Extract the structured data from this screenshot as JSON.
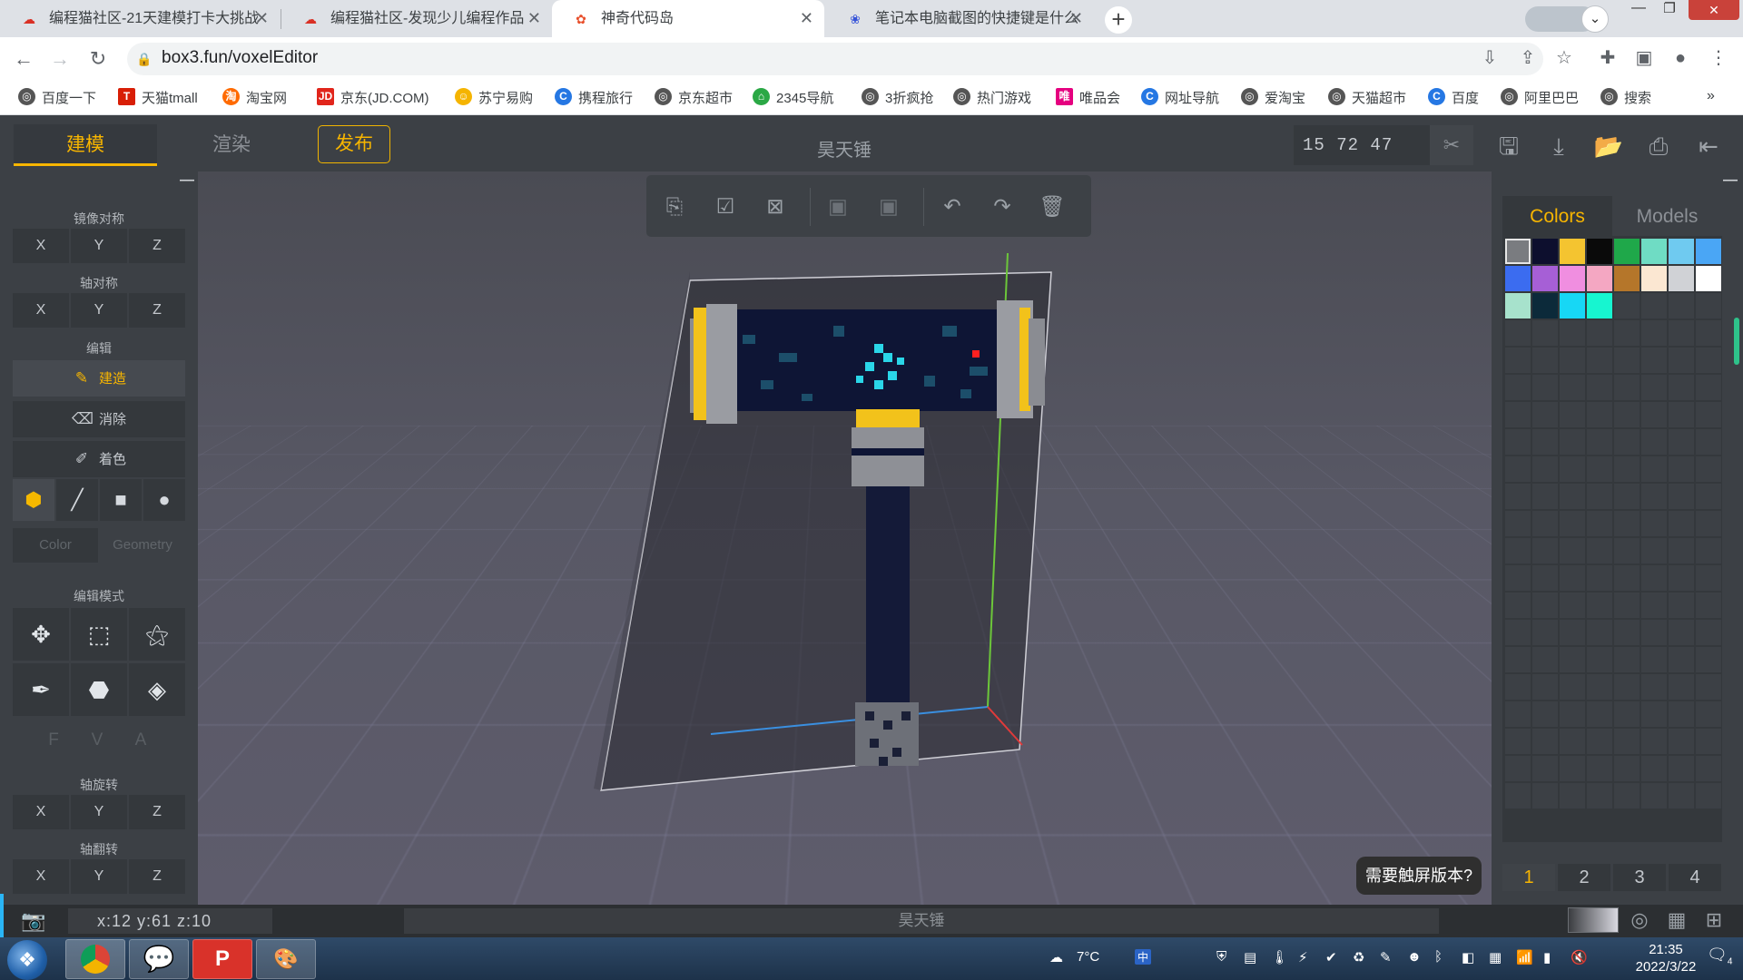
{
  "browser": {
    "tabs": [
      {
        "title": "编程猫社区-21天建模打卡大挑战",
        "active": false
      },
      {
        "title": "编程猫社区-发现少儿编程作品",
        "active": false
      },
      {
        "title": "神奇代码岛",
        "active": true
      },
      {
        "title": "笔记本电脑截图的快捷键是什么",
        "active": false
      }
    ],
    "url": "box3.fun/voxelEditor",
    "bookmarks": [
      "百度一下",
      "天猫tmall",
      "淘宝网",
      "京东(JD.COM)",
      "苏宁易购",
      "携程旅行",
      "京东超市",
      "2345导航",
      "3折疯抢",
      "热门游戏",
      "唯品会",
      "网址导航",
      "爱淘宝",
      "天猫超市",
      "百度",
      "阿里巴巴",
      "搜索"
    ]
  },
  "editor": {
    "tabs": {
      "build": "建模",
      "render": "渲染",
      "publish": "发布"
    },
    "project_title": "昊天锤",
    "dimensions": "15 72 47",
    "left_panel": {
      "mirror_label": "镜像对称",
      "axis_sym_label": "轴对称",
      "edit_label": "编辑",
      "axes": [
        "X",
        "Y",
        "Z"
      ],
      "modes": {
        "build": "建造",
        "erase": "消除",
        "paint": "着色"
      },
      "color_tab": "Color",
      "geometry_tab": "Geometry",
      "edit_mode_label": "编辑模式",
      "fva": [
        "F",
        "V",
        "A"
      ],
      "axis_rotate_label": "轴旋转",
      "axis_flip_label": "轴翻转"
    },
    "right_panel": {
      "tabs": {
        "colors": "Colors",
        "models": "Models"
      },
      "palette": [
        "#7a7c80",
        "#0d0f2e",
        "#f4c430",
        "#0a0a0a",
        "#1fa84a",
        "#6fdcc4",
        "#6fcaf0",
        "#4aa6f5",
        "#3b6cf0",
        "#a65fd6",
        "#f08ee0",
        "#f4a7c2",
        "#b5762a",
        "#fbe7d2",
        "#d0d2d6",
        "#ffffff",
        "#a7e2cc",
        "#0c2a3a",
        "#17d7f5",
        "#17f5d0"
      ],
      "pages": [
        "1",
        "2",
        "3",
        "4"
      ]
    },
    "status": {
      "cursor": "x:12 y:61 z:10",
      "name": "昊天锤"
    },
    "touch_tip": "需要触屏版本?"
  },
  "taskbar": {
    "weather": "7°C",
    "time": "21:35",
    "date": "2022/3/22",
    "notif_count": "4"
  }
}
